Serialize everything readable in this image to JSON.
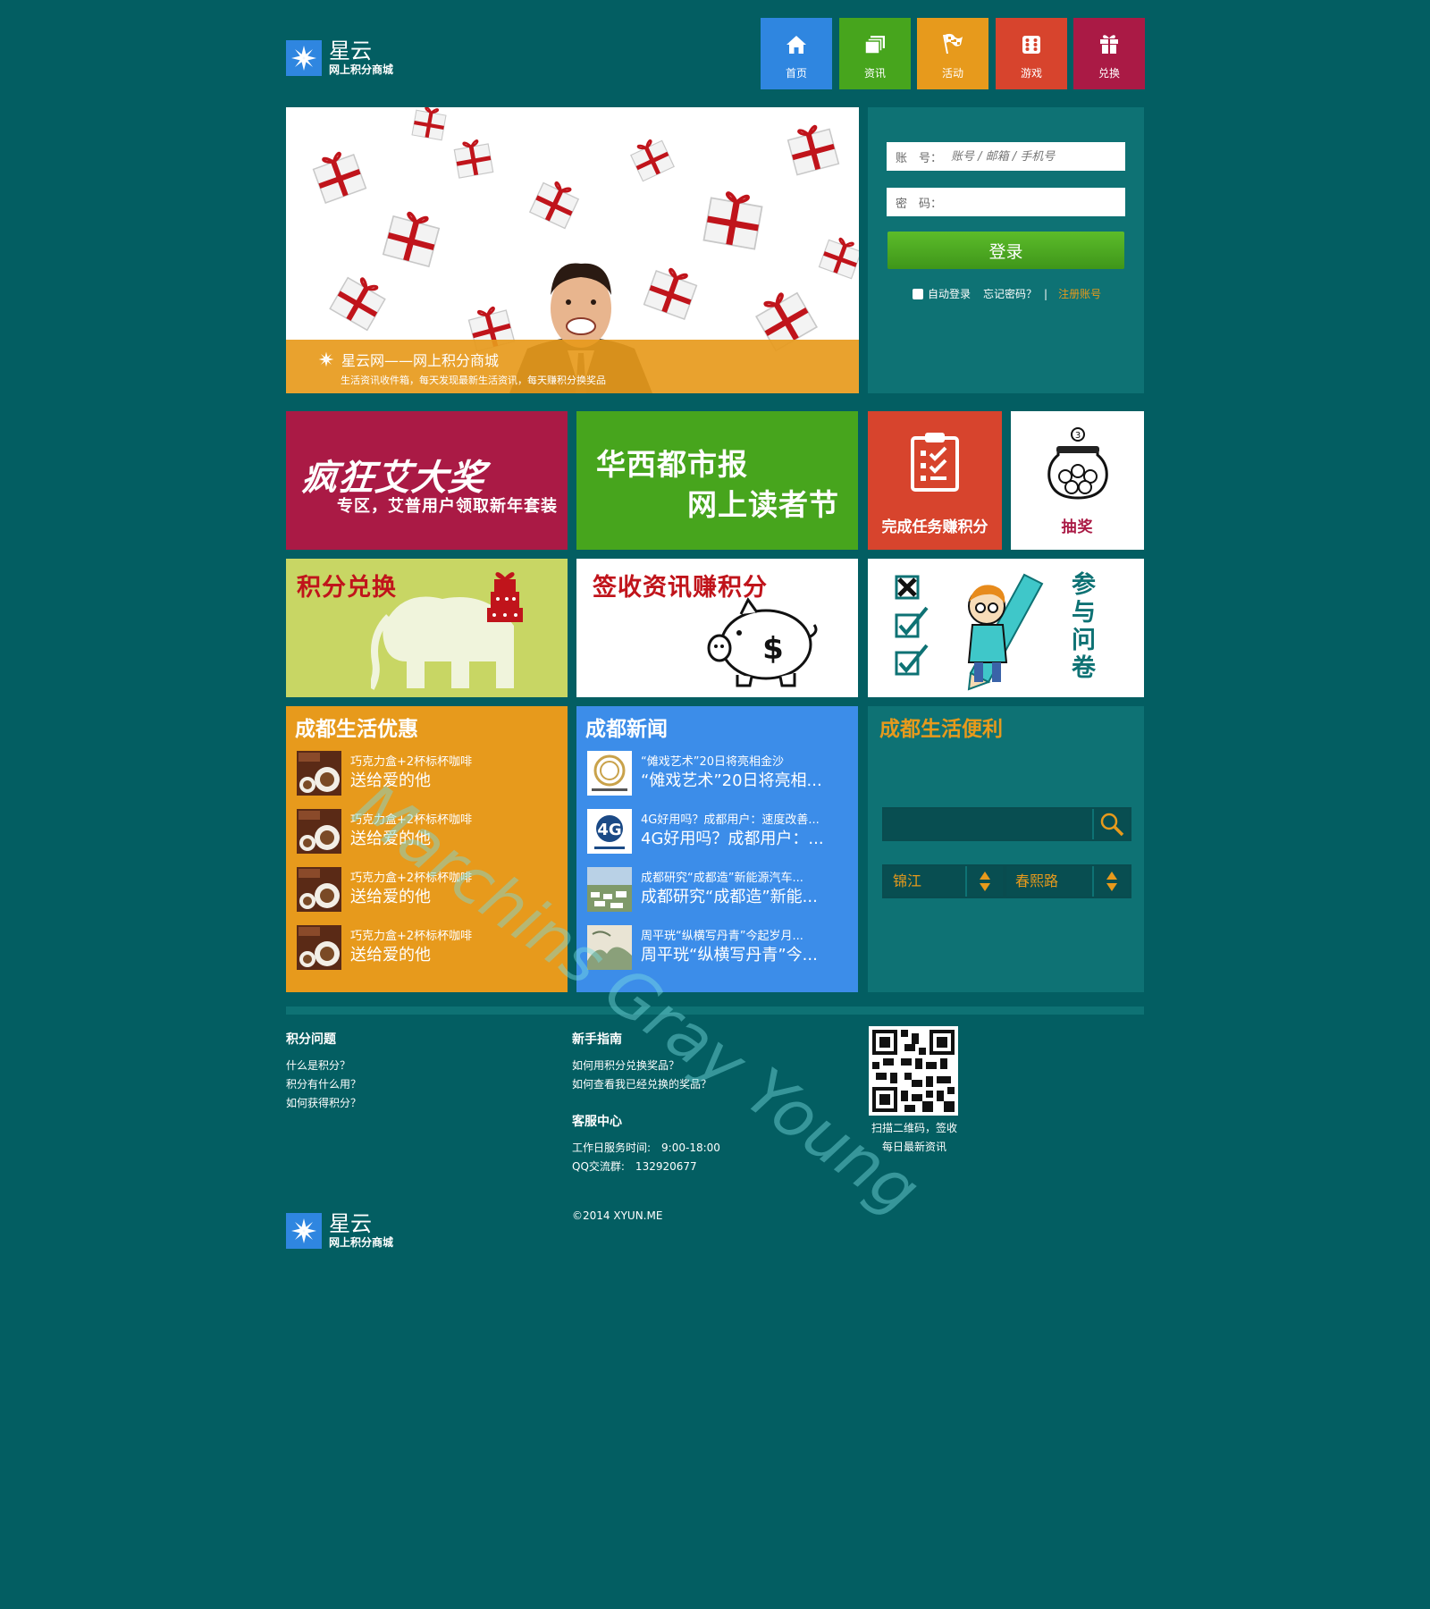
{
  "brand": {
    "name": "星云",
    "tagline": "网上积分商城"
  },
  "nav": [
    {
      "label": "首页",
      "icon": "home-icon",
      "color": "#2f86e0"
    },
    {
      "label": "资讯",
      "icon": "news-icon",
      "color": "#47a51d"
    },
    {
      "label": "活动",
      "icon": "flag-icon",
      "color": "#e79a1c"
    },
    {
      "label": "游戏",
      "icon": "dice-icon",
      "color": "#d7442d"
    },
    {
      "label": "兑换",
      "icon": "gift-icon",
      "color": "#aa1a45"
    }
  ],
  "banner": {
    "caption_title": "星云网——网上积分商城",
    "caption_sub": "生活资讯收件箱，每天发现最新生活资讯，每天赚积分换奖品"
  },
  "login": {
    "account_label": "账　号：",
    "account_placeholder": "账号 / 邮箱 / 手机号",
    "password_label": "密　码：",
    "submit": "登录",
    "remember": "自动登录",
    "forgot": "忘记密码？",
    "separator": "|",
    "register": "注册账号"
  },
  "tiles": {
    "t1_line1": "疯狂艾大奖",
    "t1_line2": "专区，艾普用户领取新年套装",
    "t2_line1": "华西都市报",
    "t2_line2": "网上读者节",
    "t3_label": "完成任务赚积分",
    "t4_label": "抽奖",
    "t5_label": "积分兑换",
    "t6_label": "签收资讯赚积分",
    "t7_label": "参与问卷"
  },
  "offers": {
    "title": "成都生活优惠",
    "items": [
      {
        "small": "巧克力盒+2杯标杯咖啡",
        "big": "送给爱的他"
      },
      {
        "small": "巧克力盒+2杯标杯咖啡",
        "big": "送给爱的他"
      },
      {
        "small": "巧克力盒+2杯标杯咖啡",
        "big": "送给爱的他"
      },
      {
        "small": "巧克力盒+2杯标杯咖啡",
        "big": "送给爱的他"
      }
    ]
  },
  "news": {
    "title": "成都新闻",
    "items": [
      {
        "small": "“傩戏艺术”20日将亮相金沙",
        "big": "“傩戏艺术”20日将亮相..."
      },
      {
        "small": "4G好用吗？成都用户：速度改善...",
        "big": "4G好用吗？成都用户：..."
      },
      {
        "small": "成都研究“成都造”新能源汽车...",
        "big": "成都研究“成都造”新能..."
      },
      {
        "small": "周平珖“纵横写丹青”今起岁月...",
        "big": "周平珖“纵横写丹青”今..."
      }
    ]
  },
  "life": {
    "title": "成都生活便利",
    "search_value": "",
    "district": "锦江",
    "road": "春熙路"
  },
  "footer": {
    "col1_title": "积分问题",
    "col1_links": [
      "什么是积分？",
      "积分有什么用？",
      "如何获得积分？"
    ],
    "col2_title": "新手指南",
    "col2_links": [
      "如何用积分兑换奖品？",
      "如何查看我已经兑换的奖品？"
    ],
    "service_title": "客服中心",
    "service_hours": "工作日服务时间:　9:00-18:00",
    "service_qq": "QQ交流群:　132920677",
    "qr_caption1": "扫描二维码，签收",
    "qr_caption2": "每日最新资讯",
    "copyright": "©2014 XYUN.ME"
  },
  "watermark": "Marchins Gray Young",
  "colors": {
    "background": "#035e62",
    "panel": "#0e7274",
    "orange": "#e79a1c",
    "blue": "#3c8de9",
    "green": "#47a51d",
    "crimson": "#aa1a45",
    "red": "#d7442d",
    "login_green": "#4aa51f"
  }
}
